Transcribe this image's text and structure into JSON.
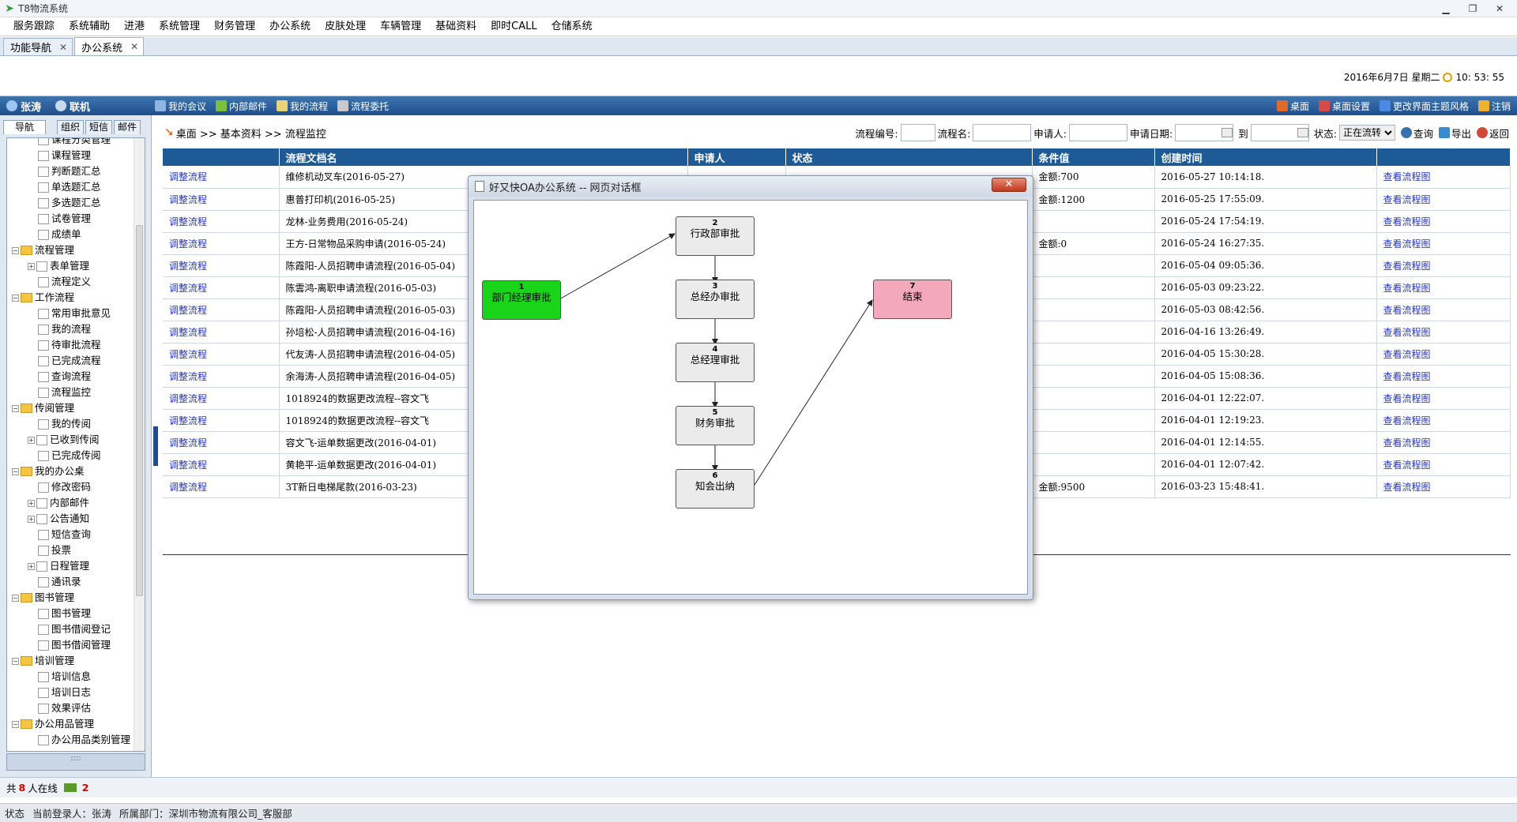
{
  "window": {
    "title": "T8物流系统",
    "minimize": "▁",
    "restore": "❐",
    "close": "✕"
  },
  "menu": [
    "服务跟踪",
    "系统辅助",
    "进港",
    "系统管理",
    "财务管理",
    "办公系统",
    "皮肤处理",
    "车辆管理",
    "基础资料",
    "即时CALL",
    "仓储系统"
  ],
  "tabs": [
    {
      "label": "功能导航",
      "close": "✕"
    },
    {
      "label": "办公系统",
      "close": "✕"
    }
  ],
  "datetime": "2016年6月7日 星期二",
  "time": "10: 53: 55",
  "bluebar": {
    "user": "张涛",
    "online": "联机",
    "left_items": [
      "我的会议",
      "内部邮件",
      "我的流程",
      "流程委托"
    ],
    "right_items": [
      "桌面",
      "桌面设置",
      "更改界面主题风格",
      "注销"
    ]
  },
  "sidebar": {
    "tabs": [
      "导航",
      "组织",
      "短信",
      "邮件"
    ],
    "tree": [
      {
        "label": "课程分类管理",
        "level": 2
      },
      {
        "label": "课程管理",
        "level": 2
      },
      {
        "label": "判断题汇总",
        "level": 2
      },
      {
        "label": "单选题汇总",
        "level": 2
      },
      {
        "label": "多选题汇总",
        "level": 2
      },
      {
        "label": "试卷管理",
        "level": 2
      },
      {
        "label": "成绩单",
        "level": 2
      },
      {
        "label": "流程管理",
        "level": 1,
        "expander": "−"
      },
      {
        "label": "表单管理",
        "level": 2,
        "expander": "+"
      },
      {
        "label": "流程定义",
        "level": 2
      },
      {
        "label": "工作流程",
        "level": 1,
        "expander": "−"
      },
      {
        "label": "常用审批意见",
        "level": 2
      },
      {
        "label": "我的流程",
        "level": 2
      },
      {
        "label": "待审批流程",
        "level": 2
      },
      {
        "label": "已完成流程",
        "level": 2
      },
      {
        "label": "查询流程",
        "level": 2
      },
      {
        "label": "流程监控",
        "level": 2
      },
      {
        "label": "传阅管理",
        "level": 1,
        "expander": "−"
      },
      {
        "label": "我的传阅",
        "level": 2
      },
      {
        "label": "已收到传阅",
        "level": 2,
        "expander": "+"
      },
      {
        "label": "已完成传阅",
        "level": 2
      },
      {
        "label": "我的办公桌",
        "level": 1,
        "expander": "−"
      },
      {
        "label": "修改密码",
        "level": 2
      },
      {
        "label": "内部邮件",
        "level": 2,
        "expander": "+"
      },
      {
        "label": "公告通知",
        "level": 2,
        "expander": "+"
      },
      {
        "label": "短信查询",
        "level": 2
      },
      {
        "label": "投票",
        "level": 2
      },
      {
        "label": "日程管理",
        "level": 2,
        "expander": "+"
      },
      {
        "label": "通讯录",
        "level": 2
      },
      {
        "label": "图书管理",
        "level": 1,
        "expander": "−"
      },
      {
        "label": "图书管理",
        "level": 2
      },
      {
        "label": "图书借阅登记",
        "level": 2
      },
      {
        "label": "图书借阅管理",
        "level": 2
      },
      {
        "label": "培训管理",
        "level": 1,
        "expander": "−"
      },
      {
        "label": "培训信息",
        "level": 2
      },
      {
        "label": "培训日志",
        "level": 2
      },
      {
        "label": "效果评估",
        "level": 2
      },
      {
        "label": "办公用品管理",
        "level": 1,
        "expander": "−"
      },
      {
        "label": "办公用品类别管理",
        "level": 2
      }
    ],
    "footer": "::::"
  },
  "breadcrumb": "桌面 >> 基本资料 >> 流程监控",
  "filters": {
    "flow_no_label": "流程编号:",
    "flow_name_label": "流程名:",
    "applicant_label": "申请人:",
    "apply_date_label": "申请日期:",
    "to_label": "到",
    "status_label": "状态:",
    "status_value": "正在流转",
    "query": "查询",
    "export": "导出",
    "back": "返回"
  },
  "table": {
    "headers": [
      "",
      "流程文档名",
      "申请人",
      "状态",
      "条件值",
      "创建时间",
      ""
    ],
    "rows": [
      [
        "调整流程",
        "维修机动叉车(2016-05-27)",
        "",
        "",
        "金额:700",
        "2016-05-27 10:14:18.",
        "查看流程图"
      ],
      [
        "调整流程",
        "惠普打印机(2016-05-25)",
        "",
        "",
        "金额:1200",
        "2016-05-25 17:55:09.",
        "查看流程图"
      ],
      [
        "调整流程",
        "龙林-业务费用(2016-05-24)",
        "",
        "",
        "",
        "2016-05-24 17:54:19.",
        "查看流程图"
      ],
      [
        "调整流程",
        "王方-日常物品采购申请(2016-05-24)",
        "",
        "",
        "金额:0",
        "2016-05-24 16:27:35.",
        "查看流程图"
      ],
      [
        "调整流程",
        "陈霞阳-人员招聘申请流程(2016-05-04)",
        "",
        "",
        "",
        "2016-05-04 09:05:36.",
        "查看流程图"
      ],
      [
        "调整流程",
        "陈雲鸿-离职申请流程(2016-05-03)",
        "",
        "",
        "",
        "2016-05-03 09:23:22.",
        "查看流程图"
      ],
      [
        "调整流程",
        "陈霞阳-人员招聘申请流程(2016-05-03)",
        "",
        "",
        "",
        "2016-05-03 08:42:56.",
        "查看流程图"
      ],
      [
        "调整流程",
        "孙培松-人员招聘申请流程(2016-04-16)",
        "",
        "",
        "",
        "2016-04-16 13:26:49.",
        "查看流程图"
      ],
      [
        "调整流程",
        "代友涛-人员招聘申请流程(2016-04-05)",
        "",
        "",
        "",
        "2016-04-05 15:30:28.",
        "查看流程图"
      ],
      [
        "调整流程",
        "余海涛-人员招聘申请流程(2016-04-05)",
        "",
        "",
        "",
        "2016-04-05 15:08:36.",
        "查看流程图"
      ],
      [
        "调整流程",
        "1018924的数据更改流程--容文飞",
        "",
        "",
        "",
        "2016-04-01 12:22:07.",
        "查看流程图"
      ],
      [
        "调整流程",
        "1018924的数据更改流程--容文飞",
        "",
        "",
        "",
        "2016-04-01 12:19:23.",
        "查看流程图"
      ],
      [
        "调整流程",
        "容文飞-运单数据更改(2016-04-01)",
        "",
        "",
        "",
        "2016-04-01 12:14:55.",
        "查看流程图"
      ],
      [
        "调整流程",
        "黄艳平-运单数据更改(2016-04-01)",
        "",
        "",
        "",
        "2016-04-01 12:07:42.",
        "查看流程图"
      ],
      [
        "调整流程",
        "3T新日电梯尾款(2016-03-23)",
        "",
        "",
        "金额:9500",
        "2016-03-23 15:48:41.",
        "查看流程图"
      ]
    ]
  },
  "dialog": {
    "title": "好又快OA办公系统 -- 网页对话框",
    "close": "✕",
    "nodes": [
      {
        "id": "n1",
        "num": "1",
        "label": "部门经理审批",
        "style": "green"
      },
      {
        "id": "n2",
        "num": "2",
        "label": "行政部审批",
        "style": "grey"
      },
      {
        "id": "n3",
        "num": "3",
        "label": "总经办审批",
        "style": "grey"
      },
      {
        "id": "n4",
        "num": "4",
        "label": "总经理审批",
        "style": "grey"
      },
      {
        "id": "n5",
        "num": "5",
        "label": "财务审批",
        "style": "grey"
      },
      {
        "id": "n6",
        "num": "6",
        "label": "知会出纳",
        "style": "grey"
      },
      {
        "id": "n7",
        "num": "7",
        "label": "结束",
        "style": "pink"
      }
    ]
  },
  "status1": {
    "prefix": "共",
    "count": "8",
    "suffix": "人在线",
    "mail_count": "2"
  },
  "status2": {
    "label": "状态",
    "login": "当前登录人：张涛",
    "dept": "所属部门：深圳市物流有限公司_客服部"
  }
}
